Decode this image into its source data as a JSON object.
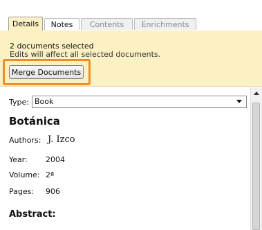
{
  "tabs": [
    {
      "label": "Details",
      "active": true
    },
    {
      "label": "Notes",
      "active": false
    },
    {
      "label": "Contents",
      "active": false
    },
    {
      "label": "Enrichments",
      "active": false
    }
  ],
  "infobar": {
    "line1": "2 documents selected",
    "line2": "Edits will affect all selected documents.",
    "merge_button": "Merge Documents",
    "highlight_color": "#f08a2d",
    "background_color": "#fbf1c2"
  },
  "details": {
    "type_label": "Type:",
    "type_value": "Book",
    "title": "Botánica",
    "authors_label": "Authors:",
    "authors_value": "J. Izco",
    "year_label": "Year:",
    "year_value": "2004",
    "volume_label": "Volume:",
    "volume_value": "2ª",
    "pages_label": "Pages:",
    "pages_value": "906",
    "abstract_label": "Abstract:"
  }
}
